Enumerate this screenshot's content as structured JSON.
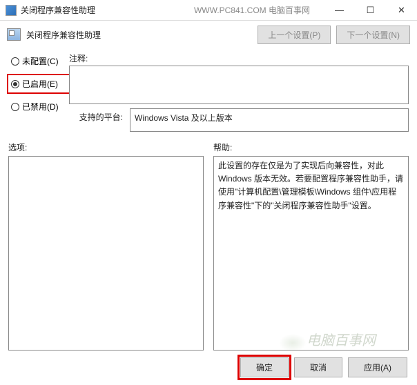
{
  "titlebar": {
    "title": "关闭程序兼容性助理",
    "center_text": "WWW.PC841.COM 电脑百事网"
  },
  "toolbar": {
    "title": "关闭程序兼容性助理",
    "prev_setting": "上一个设置(P)",
    "next_setting": "下一个设置(N)"
  },
  "radios": {
    "not_configured": "未配置(C)",
    "enabled": "已启用(E)",
    "disabled": "已禁用(D)"
  },
  "comment": {
    "label": "注释:"
  },
  "platform": {
    "label": "支持的平台:",
    "value": "Windows Vista 及以上版本"
  },
  "options": {
    "label": "选项:"
  },
  "help": {
    "label": "帮助:",
    "text": "此设置的存在仅是为了实现后向兼容性，对此 Windows 版本无效。若要配置程序兼容性助手，请使用\"计算机配置\\管理模板\\Windows 组件\\应用程序兼容性\"下的\"关闭程序兼容性助手\"设置。"
  },
  "footer": {
    "ok": "确定",
    "cancel": "取消",
    "apply": "应用(A)"
  },
  "watermark": "电脑百事网"
}
